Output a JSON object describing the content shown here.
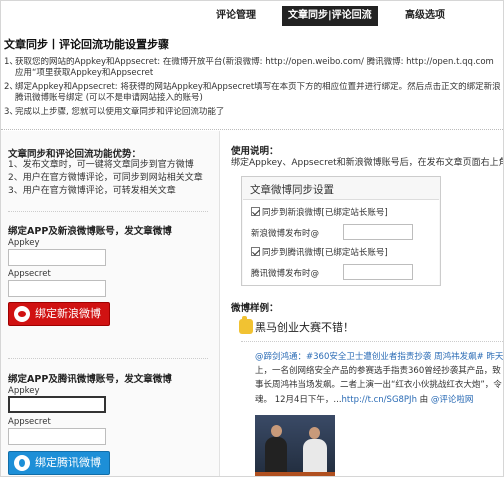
{
  "tabs": [
    {
      "label": "评论管理"
    },
    {
      "label": "文章同步|评论回流"
    },
    {
      "label": "高级选项"
    }
  ],
  "title": "文章同步丨评论回流功能设置步骤",
  "steps": [
    {
      "num": "1、",
      "line1": "获取您的网站的Appkey和Appsecret: 在微博开放平台(新浪微博: http://open.weibo.com/ 腾讯微博: http://open.t.qq.com",
      "line2": "应用“项里获取Appkey和Appsecret"
    },
    {
      "num": "2、",
      "line1": "绑定Appkey和Appsecret: 将获得的网站Appkey和Appsecret填写在本页下方的相应位置并进行绑定。然后点击正文的绑定新浪 微",
      "line2": "腾讯微博账号绑定 (可以不是申请网站接入的账号)"
    },
    {
      "num": "3、",
      "line1": "完成以上步骤, 您就可以使用文章同步和评论回流功能了",
      "line2": ""
    }
  ],
  "left": {
    "advantages_title": "文章同步和评论回流功能优势：",
    "advantages": [
      "1、发布文章时，可一键将文章同步到官方微博",
      "2、用户在官方微博评论，可同步到网站相关文章",
      "3、用户在官方微博评论，可转发相关文章"
    ],
    "sina": {
      "title": "绑定APP及新浪微博账号，发文章微博",
      "appkey_label": "Appkey",
      "appkey_value": "",
      "appsecret_label": "Appsecret",
      "appsecret_value": "",
      "button_label": "绑定新浪微博"
    },
    "qq": {
      "title": "绑定APP及腾讯微博账号，发文章微博",
      "appkey_label": "Appkey",
      "appkey_value": "",
      "appsecret_label": "Appsecret",
      "appsecret_value": "",
      "button_label": "绑定腾讯微博"
    }
  },
  "right": {
    "usage_title": "使用说明：",
    "usage_desc": "绑定Appkey、Appsecret和新浪微博账号后，在发布文章页面右上角会出",
    "sync": {
      "heading": "文章微博同步设置",
      "sina_checkbox": "同步到新浪微博[已绑定站长账号]",
      "sina_time_label": "新浪微博发布时@",
      "sina_time_value": "",
      "qq_checkbox": "同步到腾讯微博[已绑定站长账号]",
      "qq_time_label": "腾讯微博发布时@",
      "qq_time_value": ""
    },
    "example_title": "微博样例：",
    "example_headline": "黑马创业大赛不错！",
    "tweet": {
      "line1_user": "@蹄剑鸿通：",
      "line1_text": "#360安全卫士遭创业者指责抄袭 周鸿祎发飙# 昨天",
      "line2": "上，一名创网络安全产品的参赛选手指责360曾经抄袭其产品，致",
      "line3": "事长周鸿祎当场发飙。二者上演一出“红衣小伙挑战红衣大炮”，令",
      "line4_text": "魂。 12月4日下午，...",
      "line4_link": "http://t.cn/SG8PJh",
      "line4_by": " 由 ",
      "line4_source": "@评论啦网"
    }
  }
}
